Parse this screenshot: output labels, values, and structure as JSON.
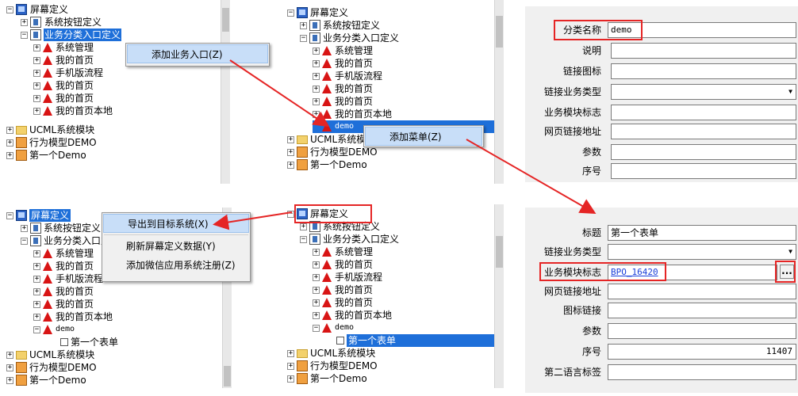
{
  "tree_root": "屏幕定义",
  "sys_btn": "系统按钮定义",
  "biz_cat": "业务分类入口定义",
  "items": [
    "系统管理",
    "我的首页",
    "手机版流程",
    "我的首页",
    "我的首页",
    "我的首页本地"
  ],
  "demo": "demo",
  "ucml": "UCML系统模块",
  "behavior": "行为模型DEMO",
  "first_demo": "第一个Demo",
  "first_form": "第一个表单",
  "menu1": {
    "add_entry": "添加业务入口(Z)"
  },
  "menu2": {
    "add_menu": "添加菜单(Z)"
  },
  "menu3": {
    "export": "导出到目标系统(X)",
    "refresh": "刷新屏幕定义数据(Y)",
    "wechat": "添加微信应用系统注册(Z)"
  },
  "form1": {
    "labels": [
      "分类名称",
      "说明",
      "链接图标",
      "链接业务类型",
      "业务模块标志",
      "网页链接地址",
      "参数",
      "序号"
    ],
    "category_value": "demo"
  },
  "form2": {
    "labels": [
      "标题",
      "链接业务类型",
      "业务模块标志",
      "网页链接地址",
      "图标链接",
      "参数",
      "序号",
      "第二语言标签"
    ],
    "title_value": "第一个表单",
    "module_value": "BPO_16420",
    "seq_value": "11407",
    "dots": "..."
  }
}
